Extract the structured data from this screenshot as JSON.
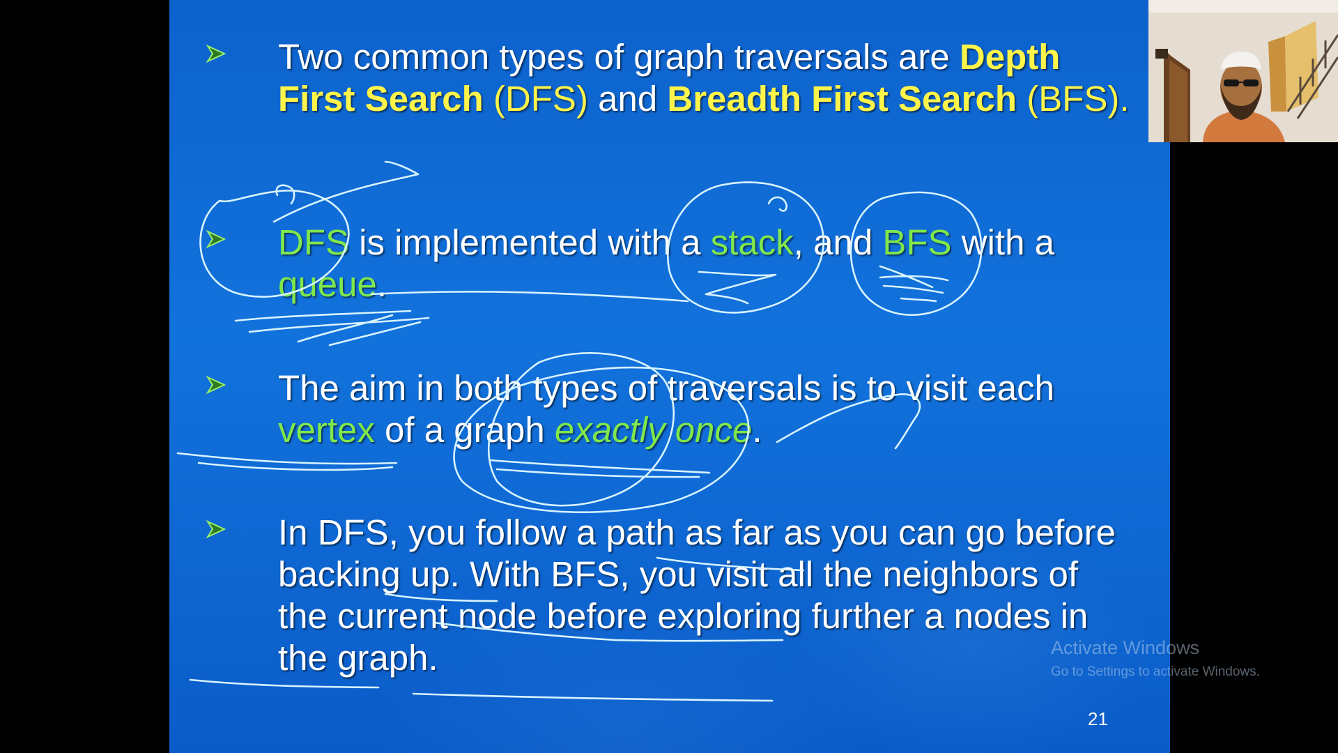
{
  "slide": {
    "bullets": [
      {
        "segments": [
          {
            "text": "Two common types of graph traversals are ",
            "style": "n"
          },
          {
            "text": "Depth First Search",
            "style": "yb"
          },
          {
            "text": " (DFS)",
            "style": "y"
          },
          {
            "text": " and ",
            "style": "n"
          },
          {
            "text": "Breadth First Search",
            "style": "yb"
          },
          {
            "text": " (BFS).",
            "style": "y"
          }
        ]
      },
      {
        "segments": [
          {
            "text": "DFS",
            "style": "g"
          },
          {
            "text": " is implemented with a ",
            "style": "n"
          },
          {
            "text": "stack",
            "style": "g"
          },
          {
            "text": ", and ",
            "style": "n"
          },
          {
            "text": "BFS",
            "style": "g"
          },
          {
            "text": " with a ",
            "style": "n"
          },
          {
            "text": "queue",
            "style": "g"
          },
          {
            "text": ".",
            "style": "n"
          }
        ]
      },
      {
        "segments": [
          {
            "text": "The aim in both types of traversals is to visit each ",
            "style": "n"
          },
          {
            "text": "vertex",
            "style": "g"
          },
          {
            "text": " of a graph ",
            "style": "n"
          },
          {
            "text": "exactly once",
            "style": "gi"
          },
          {
            "text": ".",
            "style": "n"
          }
        ]
      },
      {
        "segments": [
          {
            "text": "In DFS, you follow a path as far as you can go before backing up. With BFS, you visit all the neighbors of the current node before exploring further a nodes in the graph.",
            "style": "n"
          }
        ]
      }
    ],
    "page_number": "21",
    "bullet_icon": "arrow-bullet-icon",
    "colors": {
      "background": "#1170dc",
      "text": "#ffffff",
      "yellow_highlight": "#fff54a",
      "green_highlight": "#7fe84c",
      "annotation_ink": "#d8f4ff"
    }
  },
  "watermark": {
    "title": "Activate Windows",
    "subtitle": "Go to Settings to activate Windows."
  },
  "webcam": {
    "icon": "presenter-video-icon"
  }
}
